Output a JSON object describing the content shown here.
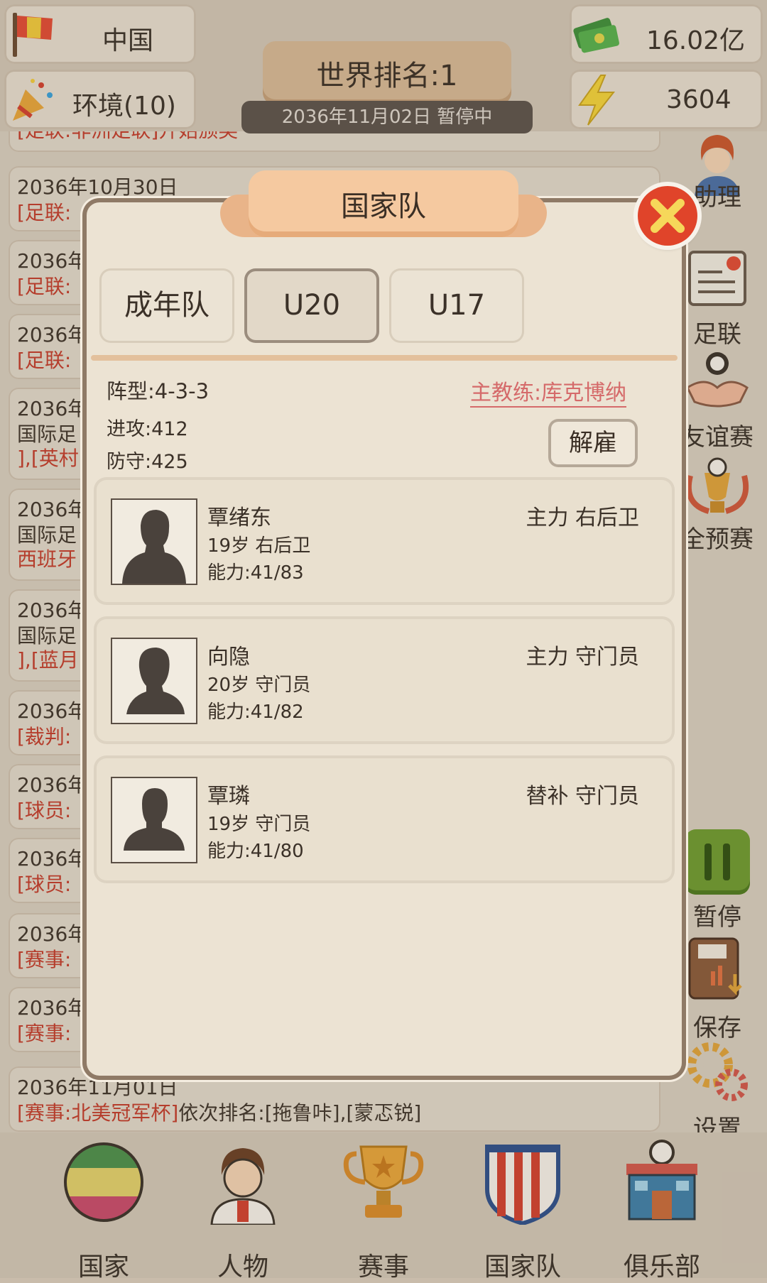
{
  "top": {
    "country": "中国",
    "environment": "环境(10)",
    "money": "16.02亿",
    "energy": "3604",
    "world_rank": "世界排名:1",
    "date_status": "2036年11月02日 暂停中"
  },
  "log": [
    {
      "date": "",
      "line1": "[足联:非洲足联]开始颁奖"
    },
    {
      "date": "2036年10月30日",
      "line1": "[足联:"
    },
    {
      "date": "2036年",
      "line1": "[足联:"
    },
    {
      "date": "2036年",
      "line1": "[足联:"
    },
    {
      "date": "2036年",
      "line1": "国际足",
      "line2": "],[英村"
    },
    {
      "date": "2036年",
      "line1": "国际足",
      "line2": "西班牙"
    },
    {
      "date": "2036年",
      "line1": "国际足",
      "line2": "],[蓝月"
    },
    {
      "date": "2036年",
      "line1": "[裁判:"
    },
    {
      "date": "2036年",
      "line1": "[球员:"
    },
    {
      "date": "2036年",
      "line1": "[球员:"
    },
    {
      "date": "2036年",
      "line1": "[赛事:"
    },
    {
      "date": "2036年",
      "line1": "[赛事:"
    },
    {
      "date": "2036年11月01日",
      "line1_red": "[赛事:北美冠军杯]",
      "line1_dark": "依次排名:[拖鲁咔],[蒙忑锐]"
    }
  ],
  "side_menu": {
    "assistant": "助理",
    "federation": "足联",
    "friendly": "友谊赛",
    "qualifiers": "全预赛",
    "pause": "暂停",
    "save": "保存",
    "settings": "设置"
  },
  "bottom_nav": {
    "country": "国家",
    "people": "人物",
    "events": "赛事",
    "national_team": "国家队",
    "club": "俱乐部"
  },
  "modal": {
    "title": "国家队",
    "tabs": [
      "成年队",
      "U20",
      "U17"
    ],
    "active_tab": "U20",
    "formation": "阵型:4-3-3",
    "attack": "进攻:412",
    "defense": "防守:425",
    "coach": "主教练:库克博纳",
    "fire_button": "解雇",
    "players": [
      {
        "name": "覃绪东",
        "info": "19岁 右后卫",
        "ability": "能力:41/83",
        "role": "主力 右后卫"
      },
      {
        "name": "向隐",
        "info": "20岁 守门员",
        "ability": "能力:41/82",
        "role": "主力 守门员"
      },
      {
        "name": "覃璘",
        "info": "19岁 守门员",
        "ability": "能力:41/80",
        "role": "替补 守门员"
      }
    ]
  },
  "colors": {
    "close_button": "#e0442a",
    "log_highlight": "#c33c2b",
    "coach_link": "#d56a6a",
    "pause_button": "#6f9a2f"
  }
}
